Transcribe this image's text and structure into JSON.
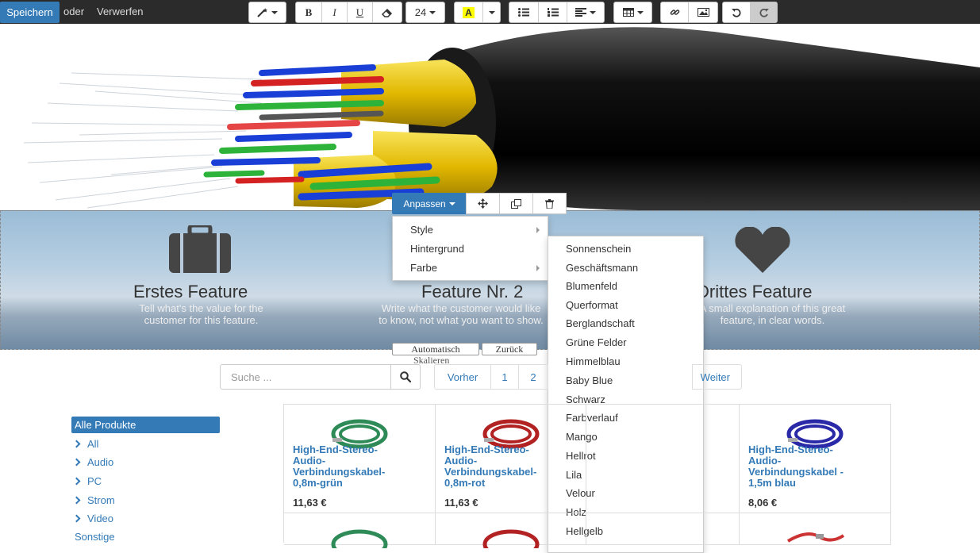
{
  "toolbar": {
    "save_label": "Speichern",
    "or_label": "oder",
    "discard_label": "Verwerfen",
    "bold": "B",
    "italic": "I",
    "underline": "U",
    "font_size": "24",
    "color_letter": "A",
    "highlight_color": "#ffff00"
  },
  "features": [
    {
      "title": "Erstes Feature",
      "text_line1": "Tell what's the value for the",
      "text_line2": "customer for this feature."
    },
    {
      "title": "Feature Nr. 2",
      "text_line1": "Write what the customer would like",
      "text_line2": "to know, not what you want to show."
    },
    {
      "title": "Drittes Feature",
      "text_line1": "A small explanation of this great",
      "text_line2": "feature, in clear words."
    }
  ],
  "block_toolbar": {
    "customize_label": "Anpassen"
  },
  "customize_menu": [
    "Style",
    "Hintergrund",
    "Farbe"
  ],
  "background_menu": [
    "Sonnenschein",
    "Geschäftsmann",
    "Blumenfeld",
    "Querformat",
    "Berglandschaft",
    "Grüne Felder",
    "Himmelblau",
    "Baby Blue",
    "Schwarz",
    "Farbverlauf",
    "Mango",
    "Hellrot",
    "Lila",
    "Velour",
    "Holz",
    "Hellgelb"
  ],
  "image_tools": {
    "auto_label": "Automatisch",
    "back_label": "Zurück",
    "scale_label": "Skalieren"
  },
  "search": {
    "placeholder": "Suche ..."
  },
  "pagination": {
    "prev": "Vorher",
    "pages": [
      "1",
      "2"
    ],
    "next": "Weiter"
  },
  "categories": {
    "active": "Alle Produkte",
    "items": [
      "All",
      "Audio",
      "PC",
      "Strom",
      "Video"
    ],
    "other": "Sonstige"
  },
  "products": [
    {
      "name_lines": [
        "High-End-Stereo-",
        "Audio-",
        "Verbindungskabel-",
        "0,8m-grün"
      ],
      "price": "11,63 €",
      "color": "#2e8b57"
    },
    {
      "name_lines": [
        "High-End-Stereo-",
        "Audio-",
        "Verbindungskabel-",
        "0,8m-rot"
      ],
      "price": "11,63 €",
      "color": "#b22222"
    },
    {
      "name_lines": [
        "High-End-Stereo-",
        "Audio-",
        "Verbindungskabel -",
        "1,5m blau"
      ],
      "price": "8,06 €",
      "color": "#2a2aa8"
    }
  ]
}
